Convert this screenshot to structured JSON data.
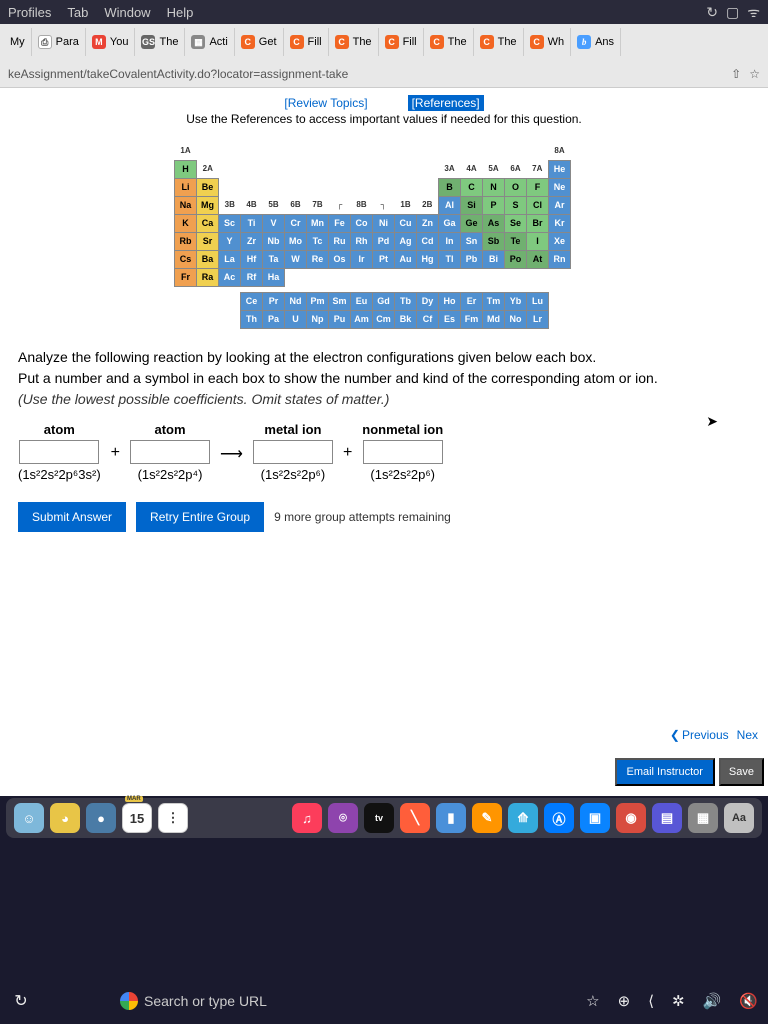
{
  "menubar": {
    "items": [
      "Profiles",
      "Tab",
      "Window",
      "Help"
    ]
  },
  "tabs": [
    {
      "icon": "",
      "cls": "",
      "label": "My"
    },
    {
      "icon": "",
      "cls": "ic-p",
      "label": "Para"
    },
    {
      "icon": "M",
      "cls": "ic-m",
      "label": "You"
    },
    {
      "icon": "GS",
      "cls": "ic-gs",
      "label": "The"
    },
    {
      "icon": "",
      "cls": "ic-a",
      "label": "Acti"
    },
    {
      "icon": "C",
      "cls": "ic-c",
      "label": "Get"
    },
    {
      "icon": "C",
      "cls": "ic-c",
      "label": "Fill"
    },
    {
      "icon": "C",
      "cls": "ic-c",
      "label": "The"
    },
    {
      "icon": "C",
      "cls": "ic-c",
      "label": "Fill"
    },
    {
      "icon": "C",
      "cls": "ic-c",
      "label": "The"
    },
    {
      "icon": "C",
      "cls": "ic-c",
      "label": "The"
    },
    {
      "icon": "C",
      "cls": "ic-c",
      "label": "Wh"
    },
    {
      "icon": "b",
      "cls": "ic-b",
      "label": "Ans"
    }
  ],
  "url": "keAssignment/takeCovalentActivity.do?locator=assignment-take",
  "links": {
    "review": "[Review Topics]",
    "references": "[References]"
  },
  "helptext": "Use the References to access important values if needed for this question.",
  "question": {
    "l1": "Analyze the following reaction by looking at the electron configurations given below each box.",
    "l2": "Put a number and a symbol in each box to show the number and kind of the corresponding atom or ion.",
    "l3": "(Use the lowest possible coefficients. Omit states of matter.)"
  },
  "eq": {
    "headers": [
      "atom",
      "atom",
      "metal ion",
      "nonmetal ion"
    ],
    "configs": [
      "(1s²2s²2p⁶3s²)",
      "(1s²2s²2p⁴)",
      "(1s²2s²2p⁶)",
      "(1s²2s²2p⁶)"
    ]
  },
  "buttons": {
    "submit": "Submit Answer",
    "retry": "Retry Entire Group"
  },
  "attempts": "9 more group attempts remaining",
  "nav": {
    "prev": "Previous",
    "next": "Nex"
  },
  "footer": {
    "email": "Email Instructor",
    "save": "Save"
  },
  "calendar": {
    "month": "MAR",
    "day": "15"
  },
  "search": "Search or type URL",
  "dock": {
    "aa": "Aa",
    "tv": "tv"
  },
  "ptable": {
    "groups_top": [
      "1A",
      "8A"
    ],
    "groups2": [
      "2A",
      "3A",
      "4A",
      "5A",
      "6A",
      "7A"
    ],
    "groups3": [
      "3B",
      "4B",
      "5B",
      "6B",
      "7B",
      "8B",
      "1B",
      "2B"
    ],
    "r1": [
      "H",
      "He"
    ],
    "r2": [
      "Li",
      "Be",
      "B",
      "C",
      "N",
      "O",
      "F",
      "Ne"
    ],
    "r3": [
      "Na",
      "Mg",
      "Al",
      "Si",
      "P",
      "S",
      "Cl",
      "Ar"
    ],
    "r4": [
      "K",
      "Ca",
      "Sc",
      "Ti",
      "V",
      "Cr",
      "Mn",
      "Fe",
      "Co",
      "Ni",
      "Cu",
      "Zn",
      "Ga",
      "Ge",
      "As",
      "Se",
      "Br",
      "Kr"
    ],
    "r5": [
      "Rb",
      "Sr",
      "Y",
      "Zr",
      "Nb",
      "Mo",
      "Tc",
      "Ru",
      "Rh",
      "Pd",
      "Ag",
      "Cd",
      "In",
      "Sn",
      "Sb",
      "Te",
      "I",
      "Xe"
    ],
    "r6": [
      "Cs",
      "Ba",
      "La",
      "Hf",
      "Ta",
      "W",
      "Re",
      "Os",
      "Ir",
      "Pt",
      "Au",
      "Hg",
      "Tl",
      "Pb",
      "Bi",
      "Po",
      "At",
      "Rn"
    ],
    "r7": [
      "Fr",
      "Ra",
      "Ac",
      "Rf",
      "Ha"
    ],
    "ln": [
      "Ce",
      "Pr",
      "Nd",
      "Pm",
      "Sm",
      "Eu",
      "Gd",
      "Tb",
      "Dy",
      "Ho",
      "Er",
      "Tm",
      "Yb",
      "Lu"
    ],
    "an": [
      "Th",
      "Pa",
      "U",
      "Np",
      "Pu",
      "Am",
      "Cm",
      "Bk",
      "Cf",
      "Es",
      "Fm",
      "Md",
      "No",
      "Lr"
    ]
  }
}
